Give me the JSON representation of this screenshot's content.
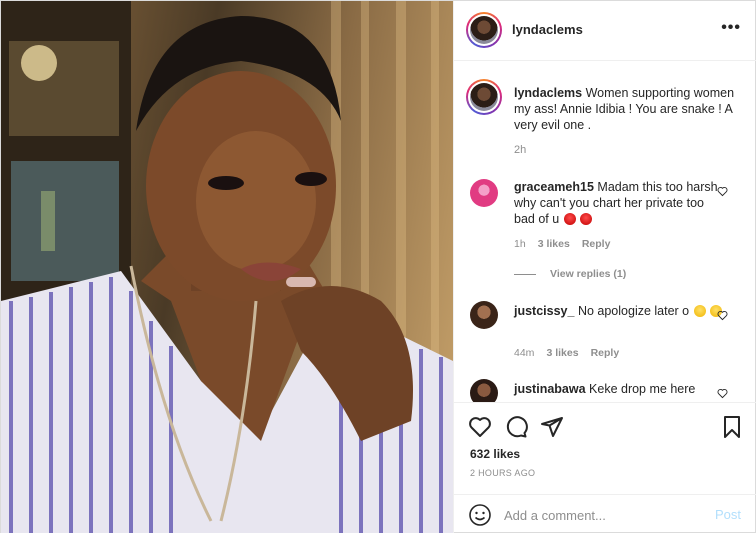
{
  "post": {
    "username": "lyndaclems",
    "more_icon": "more-horizontal-icon"
  },
  "caption": {
    "username": "lyndaclems",
    "text": "Women supporting women my ass! Annie Idibia ! You are snake ! A very evil one .",
    "time": "2h"
  },
  "comments": [
    {
      "username": "graceameh15",
      "text": "Madam this too harsh why can't you chart her private too bad of u",
      "emojis": [
        "angry-face-emoji",
        "angry-face-emoji"
      ],
      "time": "1h",
      "likes": "3 likes",
      "reply_label": "Reply",
      "view_replies": "View replies (1)",
      "avatar_color": "#e13b82"
    },
    {
      "username": "justcissy_",
      "text": "No apologize later o",
      "emojis": [
        "laughing-face-emoji",
        "laughing-face-emoji"
      ],
      "time": "44m",
      "likes": "3 likes",
      "reply_label": "Reply",
      "avatar_color": "#5a3a2a"
    },
    {
      "username": "justinabawa",
      "text": "Keke drop me here",
      "avatar_color": "#3a2a20"
    }
  ],
  "actions": {
    "likes": "632 likes",
    "posted_ago": "2 HOURS AGO"
  },
  "composer": {
    "placeholder": "Add a comment...",
    "post_label": "Post"
  },
  "colors": {
    "text": "#262626",
    "secondary": "#8e8e8e",
    "border": "#efefef",
    "post_disabled": "#b2dffc"
  }
}
